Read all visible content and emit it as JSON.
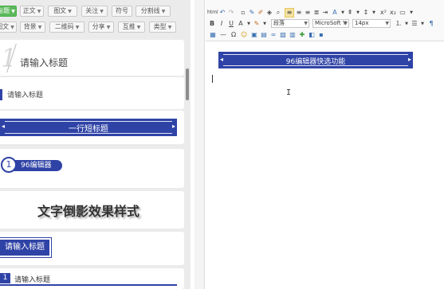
{
  "filter_bar": {
    "row1": [
      {
        "label": "标题",
        "active": true
      },
      {
        "label": "正文",
        "active": false
      },
      {
        "label": "图文",
        "active": false
      },
      {
        "label": "关注",
        "active": false
      },
      {
        "label": "符号",
        "active": false
      },
      {
        "label": "分割线",
        "active": false
      }
    ],
    "row2": [
      {
        "label": "图文",
        "active": false
      },
      {
        "label": "背景",
        "active": false
      },
      {
        "label": "二维码",
        "active": false
      },
      {
        "label": "分享",
        "active": false
      },
      {
        "label": "互推",
        "active": false
      },
      {
        "label": "类型",
        "active": false
      }
    ]
  },
  "templates": {
    "card1": {
      "number": "1",
      "title": "请输入标题"
    },
    "card2": {
      "title": "请输入标题"
    },
    "card3": {
      "title": "一行短标题"
    },
    "card4": {
      "number": "1",
      "title": "96编辑器"
    },
    "card5": {
      "title": "文字倒影效果样式"
    },
    "card6": {
      "title": "请输入标题"
    },
    "card7": {
      "number": "1",
      "title": "请输入标题"
    }
  },
  "editor": {
    "toolbar": {
      "paragraph_format": "段落",
      "font_family": "MicroSoft Y",
      "font_size": "14px"
    },
    "content": {
      "banner_title": "96编辑器快选功能"
    }
  },
  "colors": {
    "accent_blue": "#2f43a6",
    "active_green": "#5cb85c"
  },
  "icons": {
    "dropdown": "caret-down-icon",
    "banner_arrows": "arrow-icon"
  }
}
